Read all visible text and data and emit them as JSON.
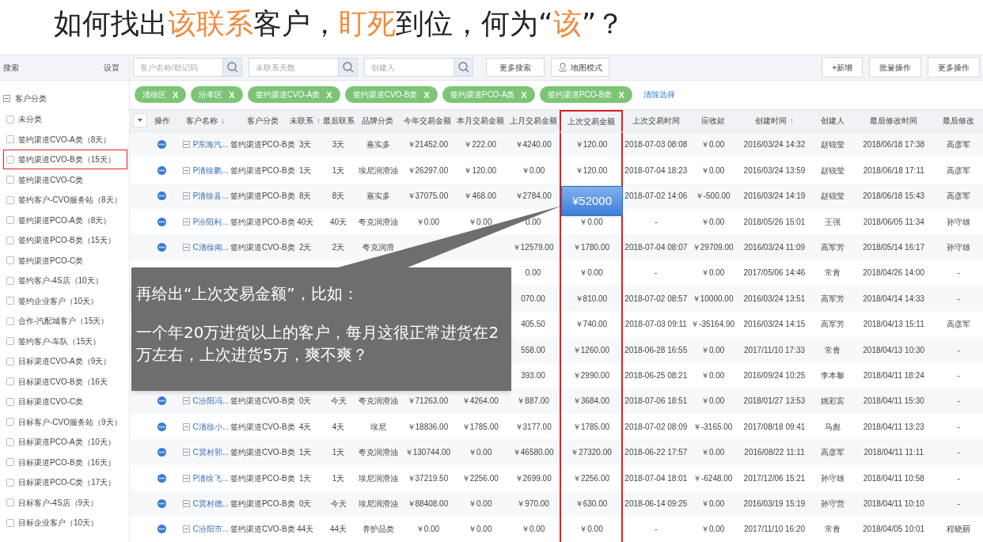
{
  "slide_title": [
    {
      "text": "如何找出",
      "accent": false
    },
    {
      "text": "该联系",
      "accent": true
    },
    {
      "text": "客户，",
      "accent": false
    },
    {
      "text": "盯死",
      "accent": true
    },
    {
      "text": "到位，何为“",
      "accent": false
    },
    {
      "text": "该",
      "accent": true
    },
    {
      "text": "”？",
      "accent": false
    }
  ],
  "sidebar": {
    "title": "搜索",
    "settings": "设置",
    "tree": {
      "label": "客户分类",
      "expanded": true,
      "children": [
        {
          "label": "未分类",
          "checked": false,
          "highlighted": false
        },
        {
          "label": "签约渠道CVO-A类（8天）",
          "checked": false,
          "highlighted": false
        },
        {
          "label": "签约渠道CVO-B类（15天）",
          "checked": false,
          "highlighted": true
        },
        {
          "label": "签约渠道CVO-C类",
          "checked": false,
          "highlighted": false
        },
        {
          "label": "签约客户-CVO服务站（8天）",
          "checked": false,
          "highlighted": false
        },
        {
          "label": "签约渠道PCO-A类（8天）",
          "checked": false,
          "highlighted": false
        },
        {
          "label": "签约渠道PCO-B类（15天）",
          "checked": false,
          "highlighted": false
        },
        {
          "label": "签约渠道PCO-C类",
          "checked": false,
          "highlighted": false
        },
        {
          "label": "签约客户-4S店（10天）",
          "checked": false,
          "highlighted": false
        },
        {
          "label": "签约企业客户（10天）",
          "checked": false,
          "highlighted": false
        },
        {
          "label": "合作-汽配城客户（15天）",
          "checked": false,
          "highlighted": false
        },
        {
          "label": "签约客户-车队（15天）",
          "checked": false,
          "highlighted": false
        },
        {
          "label": "目标渠道CVO-A类（9天）",
          "checked": false,
          "highlighted": false
        },
        {
          "label": "目标渠道CVO-B类（16天",
          "checked": false,
          "highlighted": false
        },
        {
          "label": "目标渠道CVO-C类",
          "checked": false,
          "highlighted": false
        },
        {
          "label": "目标客户-CVO服务站（9天）",
          "checked": false,
          "highlighted": false
        },
        {
          "label": "目标渠道PCO-A类（10天）",
          "checked": false,
          "highlighted": false
        },
        {
          "label": "目标渠道PCO-B类（16天）",
          "checked": false,
          "highlighted": false
        },
        {
          "label": "目标渠道PCO-C类（17天）",
          "checked": false,
          "highlighted": false
        },
        {
          "label": "目标客户-4S店（9天）",
          "checked": false,
          "highlighted": false
        },
        {
          "label": "目标企业客户（10天）",
          "checked": false,
          "highlighted": false
        }
      ]
    }
  },
  "toolbar": {
    "search_fields": [
      {
        "placeholder": "客户名称/助记码"
      },
      {
        "placeholder": "未联系天数"
      },
      {
        "placeholder": "创建人"
      }
    ],
    "more_search": "更多搜索",
    "map_mode": "地图模式",
    "actions": [
      "+新增",
      "批量操作",
      "更多操作"
    ]
  },
  "filter_tags": [
    {
      "label": "清徐区",
      "remove": "X"
    },
    {
      "label": "汾孝区",
      "remove": "X"
    },
    {
      "label": "签约渠道CVO-A类",
      "remove": "X"
    },
    {
      "label": "签约渠道CVO-B类",
      "remove": "X"
    },
    {
      "label": "签约渠道PCO-A类",
      "remove": "X"
    },
    {
      "label": "签约渠道PCO-B类",
      "remove": "X"
    }
  ],
  "clear_selection": "清除选择",
  "table": {
    "action_column": "操作",
    "columns": [
      {
        "label": "客户名称",
        "sort_mark": "↓",
        "highlighted": false
      },
      {
        "label": "客户分类",
        "highlighted": false
      },
      {
        "label": "未联系",
        "sort_mark": "↑",
        "highlighted": false
      },
      {
        "label": "最后联系",
        "highlighted": false
      },
      {
        "label": "品牌分类",
        "highlighted": false
      },
      {
        "label": "今年交易金额",
        "highlighted": false
      },
      {
        "label": "本月交易金额",
        "highlighted": false
      },
      {
        "label": "上月交易金额",
        "highlighted": false
      },
      {
        "label": "上次交易金额",
        "highlighted": true
      },
      {
        "label": "上次交易时间",
        "highlighted": false
      },
      {
        "label": "应收款",
        "highlighted": false
      },
      {
        "label": "创建时间",
        "sort_mark": "↑",
        "highlighted": false
      },
      {
        "label": "创建人",
        "highlighted": false
      },
      {
        "label": "最后修改时间",
        "highlighted": false
      },
      {
        "label": "最后修改",
        "highlighted": false
      }
    ],
    "rows": [
      {
        "cells": [
          "P东海汽...",
          "签约渠道PCO-B类",
          "3天",
          "3天",
          "嘉实多",
          "￥21452.00",
          "￥222.00",
          "￥4240.00",
          "￥120.00",
          "2018-07-03 08:08",
          "￥0.00",
          "2016/03/24 14:32",
          "赵锐莹",
          "2018/06/18 17:38",
          "高彦军"
        ]
      },
      {
        "cells": [
          "P清徐鹏...",
          "签约渠道PCO-B类",
          "1天",
          "1天",
          "埃尼润滑油",
          "￥26297.00",
          "￥120.00",
          "￥0.00",
          "￥120.00",
          "2018-07-04 18:23",
          "￥0.00",
          "2016/03/24 13:59",
          "赵锐莹",
          "2018/06/18 17:11",
          "高彦军"
        ]
      },
      {
        "cells": [
          "P清徐县...",
          "签约渠道PCO-B类",
          "8天",
          "8天",
          "嘉实多",
          "￥37075.00",
          "￥468.00",
          "￥2784.00",
          null,
          "2018-07-02 14:06",
          "￥-500.00",
          "2016/03/24 14:19",
          "赵锐莹",
          "2018/06/18 15:43",
          "高彦军"
        ]
      },
      {
        "cells": [
          "P汾阳利...",
          "签约渠道PCO-B类",
          "40天",
          "40天",
          "夸克润滑油",
          "￥0.00",
          "￥0.00",
          "0.00",
          "￥0.00",
          "-",
          "￥0.00",
          "2018/05/26 15:01",
          "王强",
          "2018/06/05 11:34",
          "孙守雄"
        ]
      },
      {
        "cells": [
          "C清徐南...",
          "签约渠道CVO-B类",
          "2天",
          "2天",
          "夸克润滑",
          null,
          null,
          "￥12579.00",
          "￥1780.00",
          "2018-07-04 08:07",
          "￥29709.00",
          "2016/03/24 11:09",
          "高军芳",
          "2018/05/14 16:17",
          "孙守雄"
        ]
      },
      {
        "cells": [
          null,
          null,
          null,
          null,
          null,
          null,
          null,
          "0.00",
          "￥0.00",
          "-",
          "￥0.00",
          "2017/05/06 14:46",
          "常青",
          "2018/04/26 14:00",
          "-"
        ]
      },
      {
        "cells": [
          null,
          null,
          null,
          null,
          null,
          null,
          null,
          "070.00",
          "￥810.00",
          "2018-07-02 08:57",
          "￥10000.00",
          "2016/03/24 13:51",
          "高军芳",
          "2018/04/14 14:33",
          "-"
        ]
      },
      {
        "cells": [
          null,
          null,
          null,
          null,
          null,
          null,
          null,
          "405.50",
          "￥740.00",
          "2018-07-03 09:11",
          "￥-35164.90",
          "2016/03/24 14:15",
          "高军芳",
          "2018/04/13 15:11",
          "高彦军"
        ]
      },
      {
        "cells": [
          null,
          null,
          null,
          null,
          null,
          null,
          null,
          "558.00",
          "￥1260.00",
          "2018-06-28 16:55",
          "￥0.00",
          "2017/11/10 17:33",
          "常青",
          "2018/04/13 10:30",
          "-"
        ]
      },
      {
        "cells": [
          null,
          null,
          null,
          null,
          null,
          null,
          null,
          "393.00",
          "￥2990.00",
          "2018-06-25 08:21",
          "￥0.00",
          "2016/09/24 10:25",
          "李本黎",
          "2018/04/11 18:24",
          "-"
        ]
      },
      {
        "cells": [
          "C汾阳冯...",
          "签约渠道CVO-B类",
          "0天",
          "今天",
          "夸克润滑油",
          "￥71263.00",
          "￥4264.00",
          "￥887.00",
          "￥3684.00",
          "2018-07-06 18:51",
          "￥0.00",
          "2018/01/27 13:53",
          "姚彩宾",
          "2018/04/11 15:30",
          "-"
        ]
      },
      {
        "cells": [
          "C清徐小...",
          "签约渠道CVO-B类",
          "4天",
          "4天",
          "埃尼",
          "￥18836.00",
          "￥1785.00",
          "￥3177.00",
          "￥1785.00",
          "2018-07-02 08:09",
          "￥-3165.00",
          "2017/08/18 09:41",
          "马彪",
          "2018/04/11 13:23",
          "-"
        ]
      },
      {
        "cells": [
          "C冀村郭...",
          "签约渠道CVO-B类",
          "1天",
          "1天",
          "夸克润滑油",
          "￥130744.00",
          "￥0.00",
          "￥46580.00",
          "￥27320.00",
          "2018-06-22 17:57",
          "￥0.00",
          "2016/08/22 11:11",
          "高彦军",
          "2018/04/11 11:11",
          "-"
        ]
      },
      {
        "cells": [
          "P清徐飞...",
          "签约渠道PCO-B类",
          "1天",
          "1天",
          "埃尼润滑油",
          "￥37219.50",
          "￥2256.00",
          "￥2699.00",
          "￥2256.00",
          "2018-07-04 18:01",
          "￥-6248.00",
          "2017/12/06 15:21",
          "孙守雄",
          "2018/04/11 10:58",
          "-"
        ]
      },
      {
        "cells": [
          "C冀村德...",
          "签约渠道PCO-B类",
          "0天",
          "今天",
          "埃尼润滑油",
          "￥88408.00",
          "￥0.00",
          "￥970.00",
          "￥630.00",
          "2018-06-14 09:25",
          "￥0.00",
          "2016/03/19 15:19",
          "孙守营",
          "2018/04/11 10:10",
          "-"
        ]
      },
      {
        "cells": [
          "C汾阳市...",
          "签约渠道CVO-B类",
          "44天",
          "44天",
          "养护品类",
          "￥0.00",
          "￥0.00",
          "￥0.00",
          "￥0.00",
          "-",
          "￥0.00",
          "2017/11/10 16:20",
          "常青",
          "2018/04/05 10:01",
          "程晓丽"
        ]
      }
    ]
  },
  "value_label": "¥52000",
  "callout": {
    "heading": "再给出“上次交易金额”，比如：",
    "body": "一个年20万进货以上的客户，每月这很正常进货在2万左右，上次进货5万，爽不爽？"
  }
}
